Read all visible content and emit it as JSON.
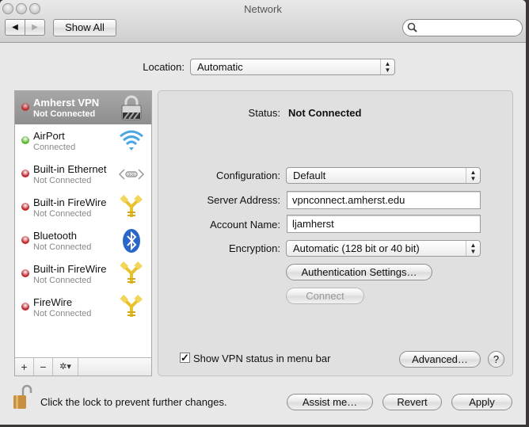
{
  "window": {
    "title": "Network"
  },
  "toolbar": {
    "back": "◀",
    "forward": "▶",
    "show_all": "Show All",
    "search_placeholder": ""
  },
  "location": {
    "label": "Location:",
    "value": "Automatic"
  },
  "services": [
    {
      "name": "Amherst VPN",
      "status": "Not Connected",
      "state": "red",
      "icon": "vpn-lock-icon",
      "selected": true
    },
    {
      "name": "AirPort",
      "status": "Connected",
      "state": "green",
      "icon": "wifi-icon"
    },
    {
      "name": "Built-in Ethernet",
      "status": "Not Connected",
      "state": "red",
      "icon": "ethernet-icon"
    },
    {
      "name": "Built-in FireWire",
      "status": "Not Connected",
      "state": "red",
      "icon": "firewire-icon"
    },
    {
      "name": "Bluetooth",
      "status": "Not Connected",
      "state": "red",
      "icon": "bluetooth-icon"
    },
    {
      "name": "Built-in FireWire",
      "status": "Not Connected",
      "state": "red",
      "icon": "firewire-icon"
    },
    {
      "name": "FireWire",
      "status": "Not Connected",
      "state": "red",
      "icon": "firewire-icon"
    }
  ],
  "list_bar": {
    "add": "+",
    "remove": "−",
    "gear": "✲▾"
  },
  "detail": {
    "status_label": "Status:",
    "status_value": "Not Connected",
    "configuration_label": "Configuration:",
    "configuration_value": "Default",
    "server_label": "Server Address:",
    "server_value": "vpnconnect.amherst.edu",
    "account_label": "Account Name:",
    "account_value": "ljamherst",
    "encryption_label": "Encryption:",
    "encryption_value": "Automatic (128 bit or 40 bit)",
    "auth_button": "Authentication Settings…",
    "connect_button": "Connect",
    "show_vpn_label": "Show VPN status in menu bar",
    "show_vpn_checked": true,
    "advanced_button": "Advanced…",
    "help": "?"
  },
  "footer": {
    "lock_text": "Click the lock to prevent further changes.",
    "assist": "Assist me…",
    "revert": "Revert",
    "apply": "Apply"
  },
  "colors": {
    "red": "#c0242b",
    "green": "#5bb52f"
  }
}
